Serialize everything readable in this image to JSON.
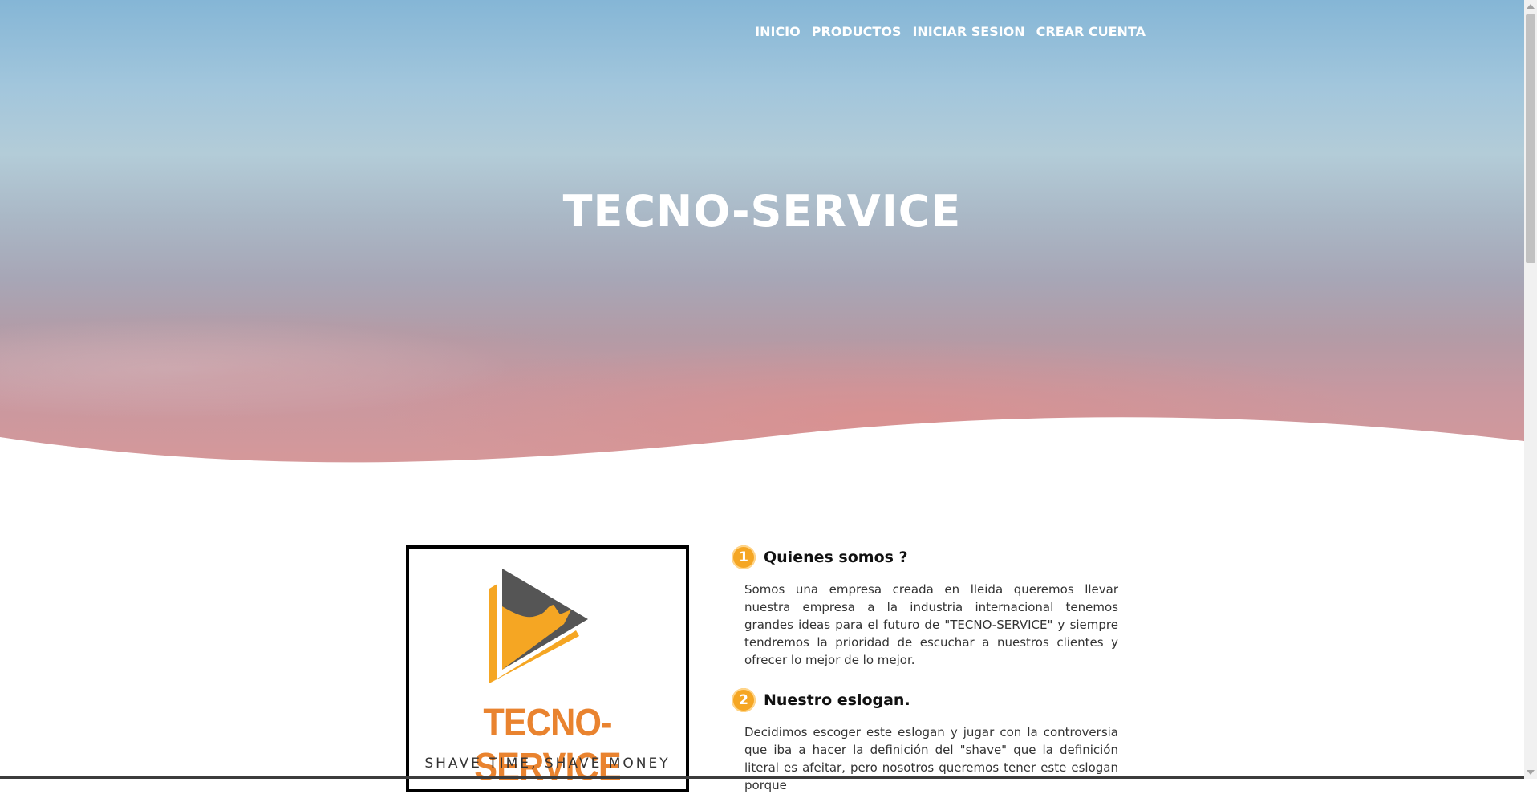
{
  "nav": {
    "items": [
      "INICIO",
      "PRODUCTOS",
      "INICIAR SESION",
      "CREAR CUENTA"
    ]
  },
  "hero": {
    "title": "TECNO-SERVICE"
  },
  "logo": {
    "name": "TECNO-SERVICE",
    "slogan": "SHAVE TIME, SHAVE MONEY",
    "icon": "play-triangle-logo-icon"
  },
  "sections": [
    {
      "number": "1",
      "title": "Quienes somos ?",
      "text": "Somos una empresa creada en lleida queremos llevar nuestra empresa a la industria internacional tenemos grandes ideas para el futuro de \"TECNO-SERVICE\" y siempre tendremos la prioridad de escuchar a nuestros clientes y ofrecer lo mejor de lo mejor."
    },
    {
      "number": "2",
      "title": "Nuestro eslogan.",
      "text": "Decidimos escoger este eslogan y jugar con la controversia que iba a hacer la definición del \"shave\" que la definición literal es afeitar, pero nosotros queremos tener este eslogan porque"
    }
  ],
  "colors": {
    "accent": "#f5a623",
    "logo_orange": "#e9832f",
    "logo_gray": "#555555"
  }
}
